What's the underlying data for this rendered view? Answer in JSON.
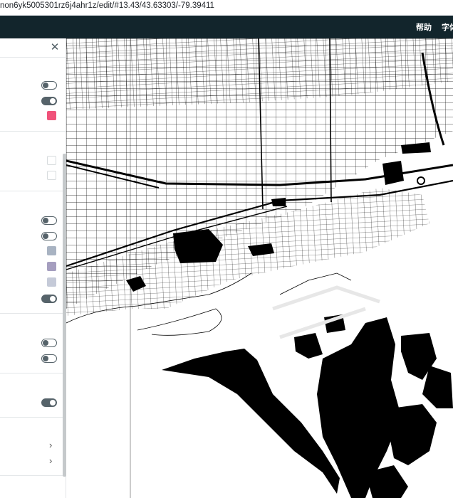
{
  "browser": {
    "url": "non6yk5005301rz6j4ahr1z/edit/#13.43/43.63303/-79.39411"
  },
  "header": {
    "menu": [
      "帮助",
      "字体"
    ]
  },
  "panel": {
    "close_icon": "close-icon",
    "toggles": [
      false,
      true,
      false,
      false,
      true,
      false,
      false,
      true
    ],
    "swatch_colors": [
      "#f0527a",
      "#ffffff",
      "#ffffff",
      "#a8b3c2",
      "#a59ebf",
      "#c5cad8"
    ],
    "chevrons": [
      "chevron-right-icon",
      "chevron-right-icon"
    ]
  },
  "map": {
    "center": {
      "zoom": 13.43,
      "lat": 43.63303,
      "lng": -79.39411
    },
    "water_color": "#ffffff",
    "land_color": "#000000"
  }
}
